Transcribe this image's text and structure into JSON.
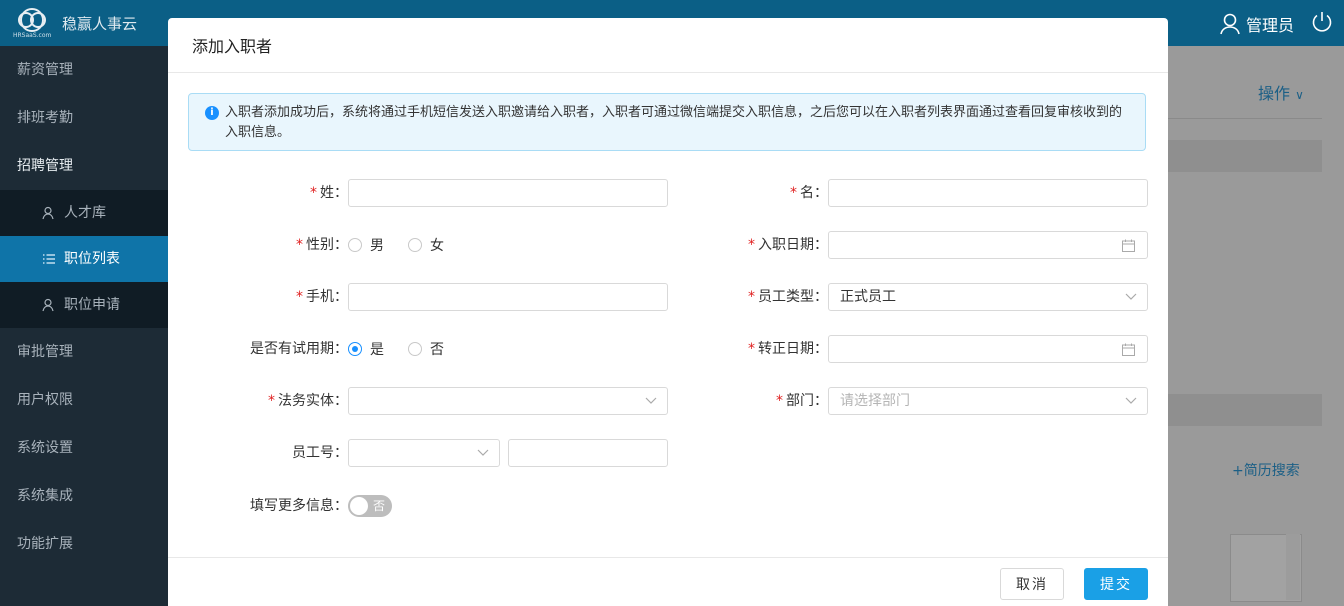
{
  "topbar": {
    "app_name": "稳赢人事云",
    "logo_sub": "HRSaaS.com",
    "user_label": "管理员"
  },
  "sidebar": {
    "items": [
      {
        "label": "薪资管理"
      },
      {
        "label": "排班考勤"
      },
      {
        "label": "招聘管理"
      },
      {
        "label": "审批管理"
      },
      {
        "label": "用户权限"
      },
      {
        "label": "系统设置"
      },
      {
        "label": "系统集成"
      },
      {
        "label": "功能扩展"
      }
    ],
    "sub_items": [
      {
        "label": "人才库",
        "icon": "person-icon"
      },
      {
        "label": "职位列表",
        "icon": "list-icon",
        "active": true
      },
      {
        "label": "职位申请",
        "icon": "person-icon"
      }
    ]
  },
  "background": {
    "action_label": "操作",
    "resume_search": "简历搜索"
  },
  "modal": {
    "title": "添加入职者",
    "notice": "入职者添加成功后，系统将通过手机短信发送入职邀请给入职者，入职者可通过微信端提交入职信息，之后您可以在入职者列表界面通过查看回复审核收到的入职信息。",
    "fields": {
      "last_name": {
        "label": "姓：",
        "value": ""
      },
      "first_name": {
        "label": "名：",
        "value": ""
      },
      "gender": {
        "label": "性别：",
        "options": [
          "男",
          "女"
        ],
        "selected": null
      },
      "entry_date": {
        "label": "入职日期：",
        "value": ""
      },
      "mobile": {
        "label": "手机：",
        "value": ""
      },
      "employee_type": {
        "label": "员工类型：",
        "value": "正式员工"
      },
      "probation": {
        "label": "是否有试用期：",
        "options": [
          "是",
          "否"
        ],
        "selected": "是"
      },
      "regular_date": {
        "label": "转正日期：",
        "value": ""
      },
      "legal_entity": {
        "label": "法务实体：",
        "value": ""
      },
      "department": {
        "label": "部门：",
        "placeholder": "请选择部门"
      },
      "employee_no": {
        "label": "员工号：",
        "prefix": "",
        "value": ""
      },
      "more_info": {
        "label": "填写更多信息：",
        "switch_text": "否",
        "on": false
      }
    },
    "buttons": {
      "cancel": "取消",
      "submit": "提交"
    }
  },
  "colors": {
    "topbar": "#0b5f86",
    "sidebar": "#1d2b36",
    "sidebar_active": "#0f74a8",
    "primary": "#1aa0e6",
    "required": "#e02020"
  }
}
